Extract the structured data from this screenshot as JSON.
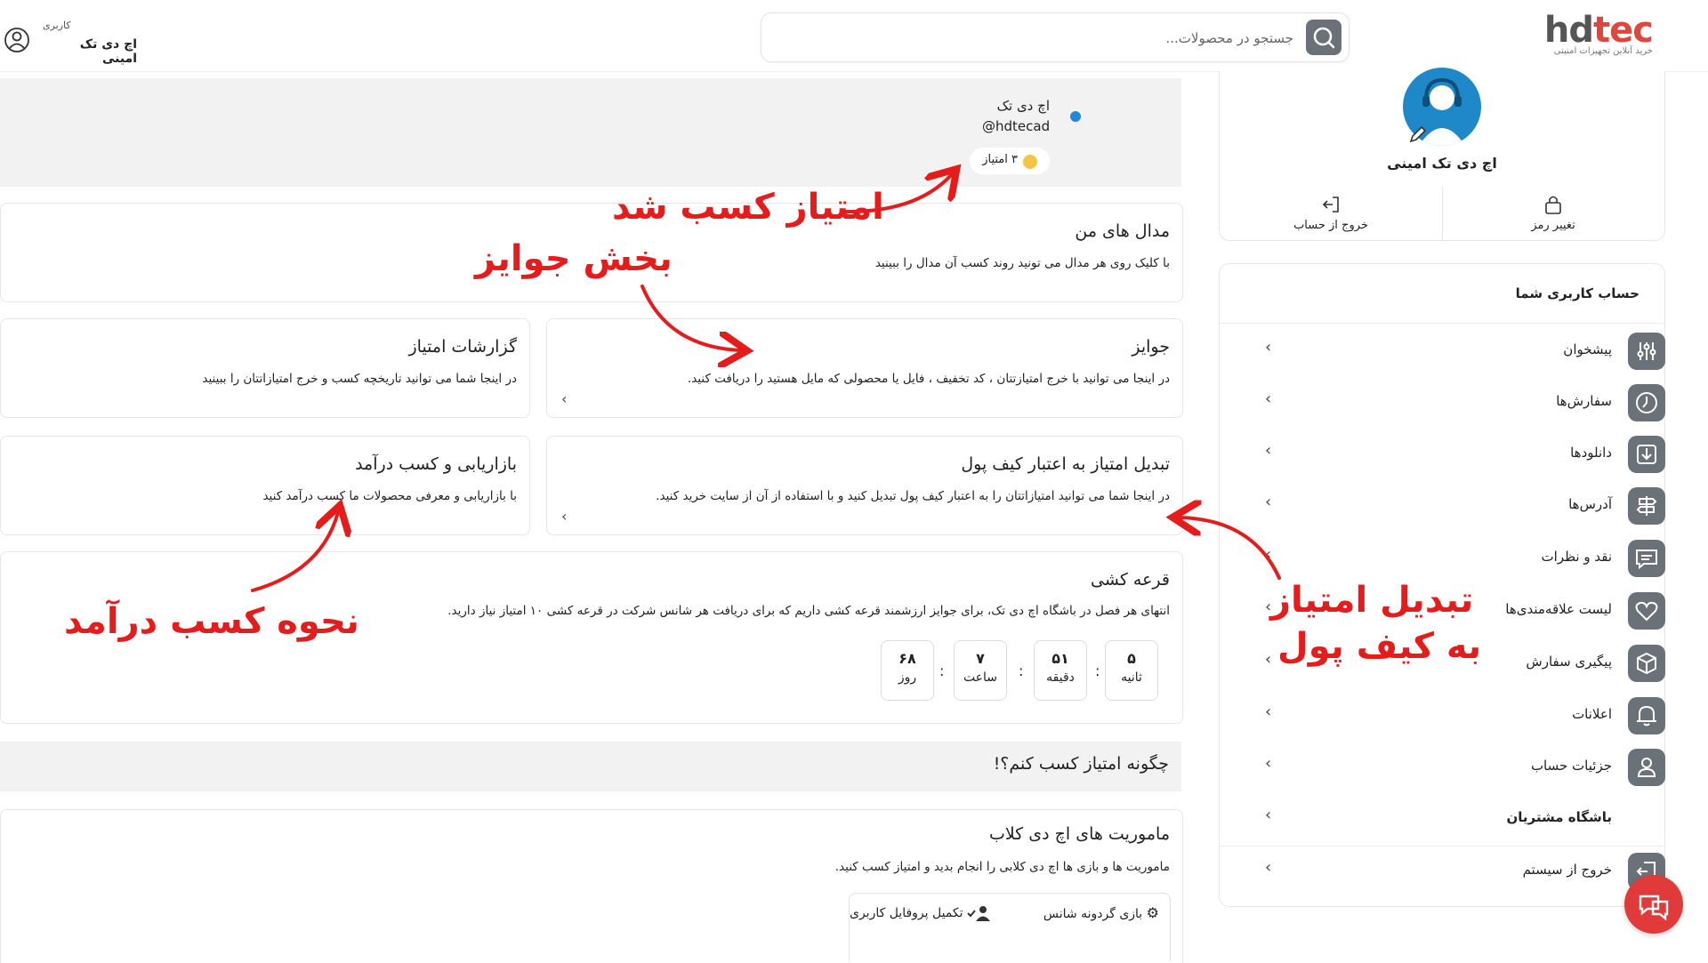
{
  "header": {
    "logo_main": "hdtec",
    "logo_tagline": "خرید آنلاین تجهیزات امنیتی",
    "search_placeholder": "جستجو در محصولات...",
    "user_role": "کاربری",
    "user_name": "اچ دی تک امینی"
  },
  "profile_card": {
    "name": "اچ دی تک امینی",
    "change_password": "تغییر رمز",
    "logout": "خروج از حساب"
  },
  "sidebar": {
    "title": "حساب کاربری شما",
    "items": [
      {
        "label": "پیشخوان",
        "icon": "dashboard-icon"
      },
      {
        "label": "سفارش‌ها",
        "icon": "orders-icon"
      },
      {
        "label": "دانلودها",
        "icon": "download-icon"
      },
      {
        "label": "آدرس‌ها",
        "icon": "address-icon"
      },
      {
        "label": "نقد و نظرات",
        "icon": "comment-icon"
      },
      {
        "label": "لیست علاقه‌مندی‌ها",
        "icon": "heart-icon"
      },
      {
        "label": "پیگیری سفارش",
        "icon": "package-icon"
      },
      {
        "label": "اعلانات",
        "icon": "bell-icon"
      },
      {
        "label": "جزئیات حساب",
        "icon": "user-icon"
      },
      {
        "label": "باشگاه مشتریان",
        "icon": ""
      },
      {
        "label": "خروج از سیستم",
        "icon": "logout-icon"
      }
    ]
  },
  "club_header": {
    "name": "اچ دی تک",
    "handle": "@hdtecad",
    "points": "۳ امتیاز"
  },
  "medals": {
    "title": "مدال های من",
    "desc": "با کلیک روی هر مدال می تونید روند کسب آن مدال را ببینید"
  },
  "rewards": {
    "title": "جوایز",
    "desc": "در اینجا می توانید با خرج امتیازتتان ، کد تخفیف ، فایل یا محصولی که مایل هستید را دریافت کنید."
  },
  "reports": {
    "title": "گزارشات امتیاز",
    "desc": "در اینجا شما می توانید تاریخچه کسب و خرج امتیازاتتان را ببینید"
  },
  "wallet": {
    "title": "تبدیل امتیاز به اعتبار کیف پول",
    "desc": "در اینجا شما می توانید امتیازاتتان را به اعتبار کیف پول تبدیل کنید و با استفاده از آن از سایت خرید کنید."
  },
  "marketing": {
    "title": "بازاریابی و کسب درآمد",
    "desc": "با بازاریابی و معرفی محصولات ما کسب درآمد کنید"
  },
  "lottery": {
    "title": "قرعه کشی",
    "desc": "انتهای هر فصل در باشگاه اچ دی تک، برای جوایز ارزشمند قرعه کشی داریم که برای دریافت هر شانس شرکت در قرعه کشی ۱۰ امتیاز نیاز دارید.",
    "timer": [
      {
        "num": "۵",
        "label": "ثانیه"
      },
      {
        "num": "۵۱",
        "label": "دقیقه"
      },
      {
        "num": "۷",
        "label": "ساعت"
      },
      {
        "num": "۶۸",
        "label": "روز"
      }
    ]
  },
  "how_to_earn": {
    "title": "چگونه امتیاز کسب کنم؟!"
  },
  "missions": {
    "title": "ماموریت های اچ دی کلاب",
    "desc": "ماموریت ها و بازی ها اچ دی کلابی را انجام بدید و امتیاز کسب کنید.",
    "item1": "بازی گردونه شانس",
    "item2": "تکمیل پروفایل کاربری"
  },
  "annotations": {
    "points_earned": "امتیاز کسب شد",
    "rewards_section": "بخش جوایز",
    "wallet_line1": "تبدیل امتیاز",
    "wallet_line2": "به کیف پول",
    "earn_income": "نحوه کسب درآمد"
  },
  "colors": {
    "accent_red": "#e51c1c",
    "icon_grey": "#6b7178",
    "avatar_blue": "#1e88c9"
  }
}
